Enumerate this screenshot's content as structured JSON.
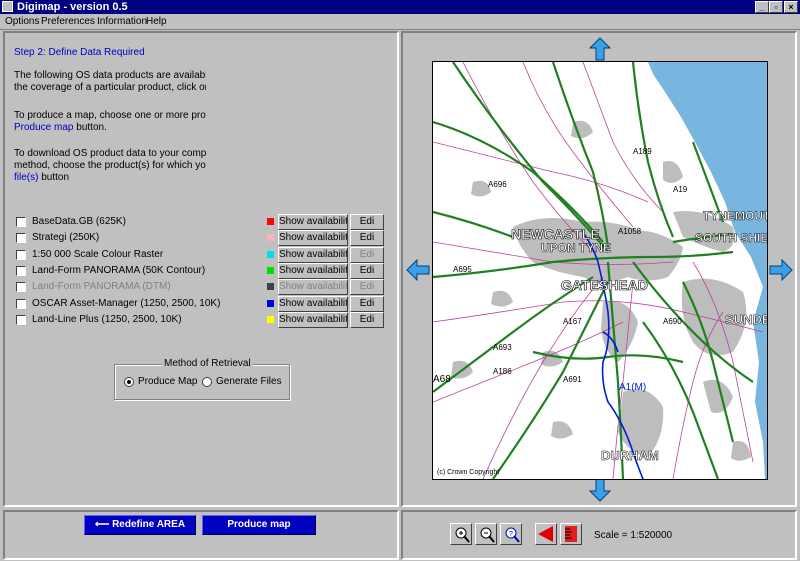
{
  "window": {
    "title": "Digimap - version 0.5",
    "min": "_",
    "max": "▫",
    "close": "×"
  },
  "menu": [
    "Options",
    "Preferences",
    "Information",
    "Help"
  ],
  "left": {
    "step": "Step 2: Define Data Required",
    "para1": [
      "The following OS data products are available for t",
      "the coverage of a particular product, click on the"
    ],
    "para2_text": "To produce a map, choose one or more products",
    "para2_link": "Produce map",
    "para2_tail": " button.",
    "para3": [
      "To download OS product data to your computer,",
      "method, choose the product(s) for which you wa"
    ],
    "para3_link": "file(s)",
    "para3_tail": " button",
    "products": [
      {
        "label": "BaseData.GB (625K)",
        "color": "#ff0000",
        "avail": "Show availability",
        "edit": "Edi",
        "dim": false
      },
      {
        "label": "Strategi (250K)",
        "color": "#ffb0c0",
        "avail": "Show availability",
        "edit": "Edi",
        "dim": false
      },
      {
        "label": "1:50 000 Scale Colour Raster",
        "color": "#00e0e0",
        "avail": "Show availability",
        "edit": "Edi",
        "dim": false
      },
      {
        "label": "Land-Form PANORAMA (50K Contour)",
        "color": "#00e000",
        "avail": "Show availability",
        "edit": "Edi",
        "dim": false
      },
      {
        "label": "Land-Form PANORAMA (DTM)",
        "color": "#404040",
        "avail": "Show availability",
        "edit": "Edi",
        "dim": true
      },
      {
        "label": "OSCAR Asset-Manager (1250, 2500, 10K)",
        "color": "#0000e0",
        "avail": "Show availability",
        "edit": "Edi",
        "dim": false
      },
      {
        "label": "Land-Line Plus (1250, 2500, 10K)",
        "color": "#ffff00",
        "avail": "Show availability",
        "edit": "Edi",
        "dim": false
      }
    ],
    "method": {
      "title": "Method of Retrieval",
      "opt1": "Produce Map",
      "opt2": "Generate Files"
    }
  },
  "map": {
    "labels": [
      "NEWCASTLE",
      "UPON TYNE",
      "GATESHEAD",
      "TYNEMOUTH",
      "SOUTH SHIELDS",
      "SUNDERLAND",
      "DURHAM",
      "A1(M)",
      "A189",
      "A19",
      "A1058",
      "A690",
      "A167",
      "A693",
      "A68",
      "A691",
      "A186",
      "A695",
      "A696"
    ],
    "copyright": "(c) Crown Copyright"
  },
  "bottom": {
    "redefine": "Redefine AREA",
    "produce": "Produce map",
    "scale": "Scale = 1:520000"
  },
  "colors": {
    "sea": "#78b6e0",
    "road_green": "#208020",
    "road_blue": "#0020d0",
    "urban": "#bdbdbd",
    "minor": "#c040a0"
  }
}
